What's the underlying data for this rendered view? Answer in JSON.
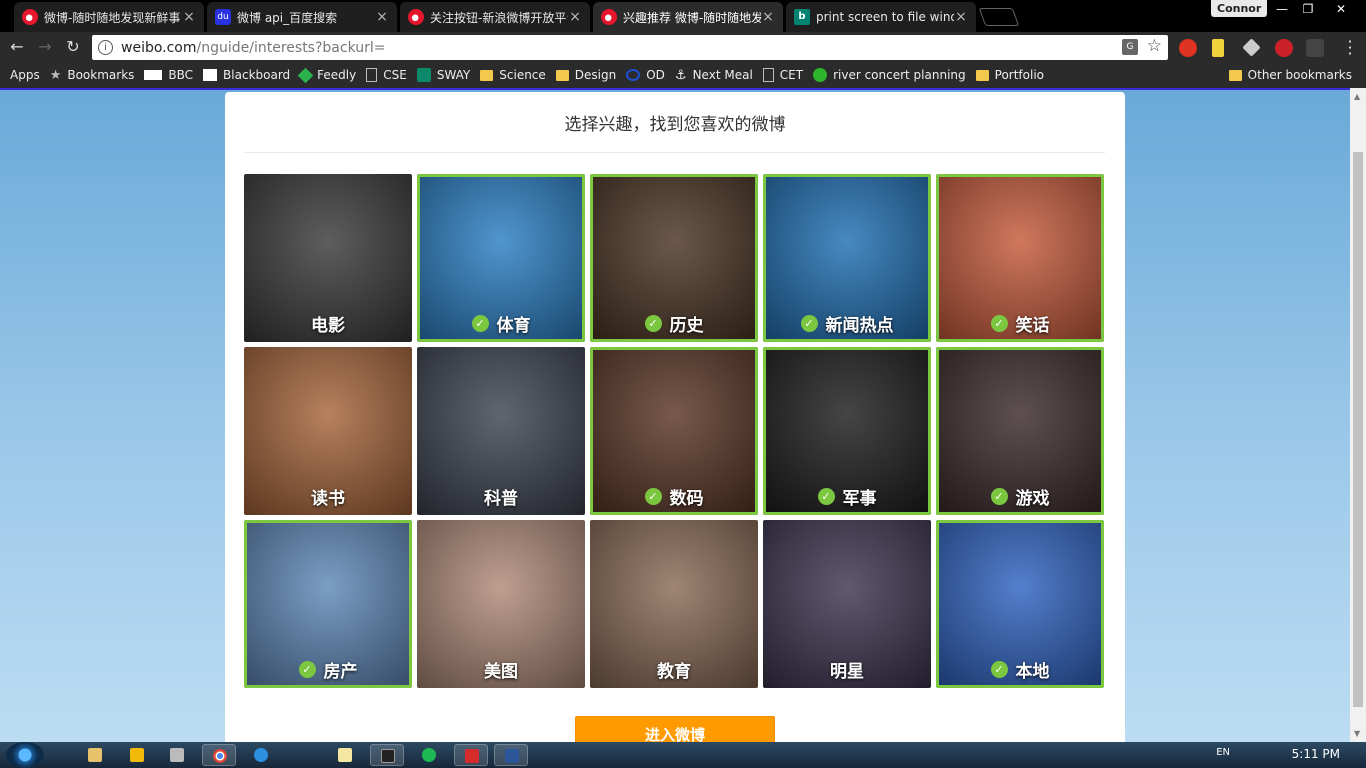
{
  "tabs": [
    {
      "title": "微博-随时随地发现新鲜事",
      "favicon": "weibo-icon",
      "active": false
    },
    {
      "title": "微博 api_百度搜索",
      "favicon": "baidu-icon",
      "active": false
    },
    {
      "title": "关注按钮-新浪微博开放平台",
      "favicon": "weibo-icon",
      "active": false
    },
    {
      "title": "兴趣推荐 微博-随时随地发现新鲜事",
      "favicon": "weibo-icon",
      "active": true
    },
    {
      "title": "print screen to file windows",
      "favicon": "bing-icon",
      "active": false
    }
  ],
  "profile_name": "Connor",
  "address": {
    "domain": "weibo.com",
    "path": "/nguide/interests?backurl="
  },
  "bookmarks": [
    {
      "label": "Apps",
      "icon": "apps-grid-icon"
    },
    {
      "label": "Bookmarks",
      "icon": "star-icon"
    },
    {
      "label": "BBC",
      "icon": "bbc-icon"
    },
    {
      "label": "Blackboard",
      "icon": "blackboard-icon"
    },
    {
      "label": "Feedly",
      "icon": "feedly-icon"
    },
    {
      "label": "CSE",
      "icon": "page-icon"
    },
    {
      "label": "SWAY",
      "icon": "sway-icon"
    },
    {
      "label": "Science",
      "icon": "folder-icon"
    },
    {
      "label": "Design",
      "icon": "folder-icon"
    },
    {
      "label": "OD",
      "icon": "od-icon"
    },
    {
      "label": "Next Meal",
      "icon": "anchor-icon"
    },
    {
      "label": "CET",
      "icon": "page-icon"
    },
    {
      "label": "river concert planning",
      "icon": "green-dot-icon"
    },
    {
      "label": "Portfolio",
      "icon": "folder-icon"
    }
  ],
  "other_bookmarks": "Other bookmarks",
  "page": {
    "heading": "选择兴趣，找到您喜欢的微博",
    "enter_button": "进入微博",
    "interests": [
      {
        "label": "电影",
        "selected": false,
        "bg": "#3a3a3a"
      },
      {
        "label": "体育",
        "selected": true,
        "bg": "#2a7fc4"
      },
      {
        "label": "历史",
        "selected": true,
        "bg": "#4a3322"
      },
      {
        "label": "新闻热点",
        "selected": true,
        "bg": "#1f6fb3"
      },
      {
        "label": "笑话",
        "selected": true,
        "bg": "#c65a3a"
      },
      {
        "label": "读书",
        "selected": false,
        "bg": "#a8653a"
      },
      {
        "label": "科普",
        "selected": false,
        "bg": "#3d4350"
      },
      {
        "label": "数码",
        "selected": true,
        "bg": "#5a3524"
      },
      {
        "label": "军事",
        "selected": true,
        "bg": "#1c1c1c"
      },
      {
        "label": "游戏",
        "selected": true,
        "bg": "#3b2a2a"
      },
      {
        "label": "房产",
        "selected": true,
        "bg": "#5f88b8"
      },
      {
        "label": "美图",
        "selected": false,
        "bg": "#b08a78"
      },
      {
        "label": "教育",
        "selected": false,
        "bg": "#8a6a55"
      },
      {
        "label": "明星",
        "selected": false,
        "bg": "#3d3550"
      },
      {
        "label": "本地",
        "selected": true,
        "bg": "#2e63c2"
      }
    ]
  },
  "taskbar": {
    "language": "EN",
    "clock": "5:11 PM"
  }
}
